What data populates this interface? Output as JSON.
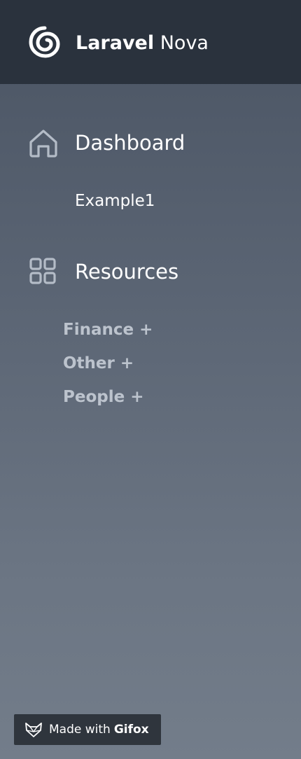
{
  "header": {
    "brand_bold": "Laravel",
    "brand_rest": "Nova",
    "logo_icon": "nova-spiral-logo"
  },
  "nav": {
    "dashboard": {
      "icon": "home-icon",
      "label": "Dashboard",
      "items": [
        "Example1"
      ]
    },
    "resources": {
      "icon": "grid-icon",
      "label": "Resources",
      "groups": [
        "Finance +",
        "Other +",
        "People +"
      ]
    }
  },
  "watermark": {
    "prefix": "Made with",
    "brand": "Gifox",
    "icon": "fox-icon"
  },
  "colors": {
    "header_bg": "#2a323d",
    "sidebar_top": "#4a5463",
    "sidebar_bottom": "#737d8a",
    "group_text": "#bcc3cd",
    "nav_text": "#ffffff"
  }
}
